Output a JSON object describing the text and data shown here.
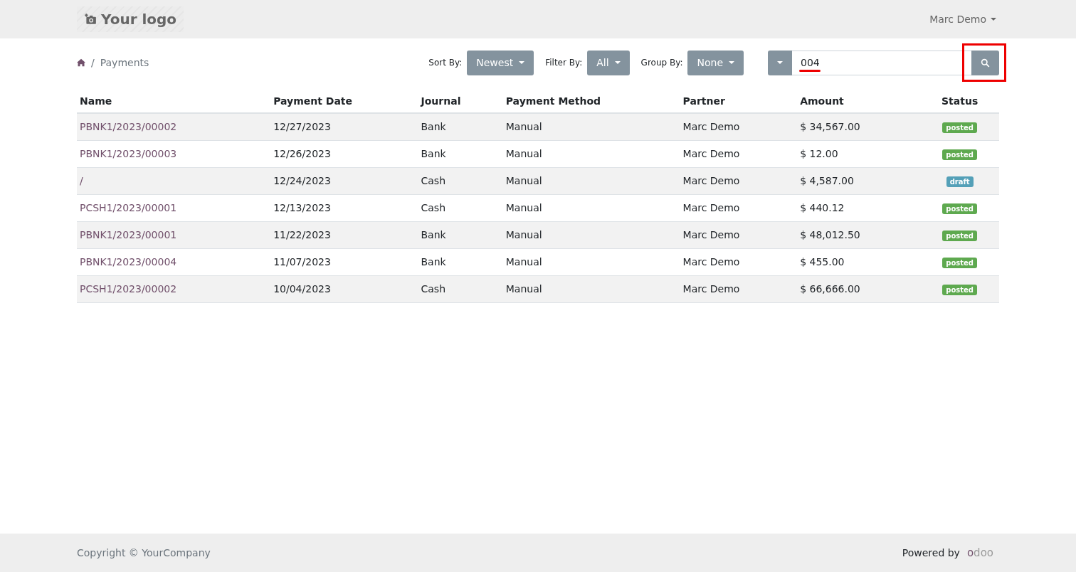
{
  "header": {
    "logo": "Your logo",
    "user": "Marc Demo"
  },
  "breadcrumb": {
    "separator": "/",
    "current": "Payments"
  },
  "controls": [
    {
      "label": "Sort By:",
      "value": "Newest"
    },
    {
      "label": "Filter By:",
      "value": "All"
    },
    {
      "label": "Group By:",
      "value": "None"
    }
  ],
  "search": {
    "value": "004"
  },
  "table": {
    "columns": [
      "Name",
      "Payment Date",
      "Journal",
      "Payment Method",
      "Partner",
      "Amount",
      "Status"
    ],
    "rows": [
      {
        "name": "PBNK1/2023/00002",
        "date": "12/27/2023",
        "journal": "Bank",
        "method": "Manual",
        "partner": "Marc Demo",
        "amount": "$ 34,567.00",
        "status": "posted",
        "color": "#5ea94f"
      },
      {
        "name": "PBNK1/2023/00003",
        "date": "12/26/2023",
        "journal": "Bank",
        "method": "Manual",
        "partner": "Marc Demo",
        "amount": "$ 12.00",
        "status": "posted",
        "color": "#5ea94f"
      },
      {
        "name": "/",
        "date": "12/24/2023",
        "journal": "Cash",
        "method": "Manual",
        "partner": "Marc Demo",
        "amount": "$ 4,587.00",
        "status": "draft",
        "color": "#54a0b8"
      },
      {
        "name": "PCSH1/2023/00001",
        "date": "12/13/2023",
        "journal": "Cash",
        "method": "Manual",
        "partner": "Marc Demo",
        "amount": "$ 440.12",
        "status": "posted",
        "color": "#5ea94f"
      },
      {
        "name": "PBNK1/2023/00001",
        "date": "11/22/2023",
        "journal": "Bank",
        "method": "Manual",
        "partner": "Marc Demo",
        "amount": "$ 48,012.50",
        "status": "posted",
        "color": "#5ea94f"
      },
      {
        "name": "PBNK1/2023/00004",
        "date": "11/07/2023",
        "journal": "Bank",
        "method": "Manual",
        "partner": "Marc Demo",
        "amount": "$ 455.00",
        "status": "posted",
        "color": "#5ea94f"
      },
      {
        "name": "PCSH1/2023/00002",
        "date": "10/04/2023",
        "journal": "Cash",
        "method": "Manual",
        "partner": "Marc Demo",
        "amount": "$ 66,666.00",
        "status": "posted",
        "color": "#5ea94f"
      }
    ]
  },
  "footer": {
    "copyright": "Copyright © YourCompany",
    "powered": "Powered by",
    "brand": "odoo"
  }
}
